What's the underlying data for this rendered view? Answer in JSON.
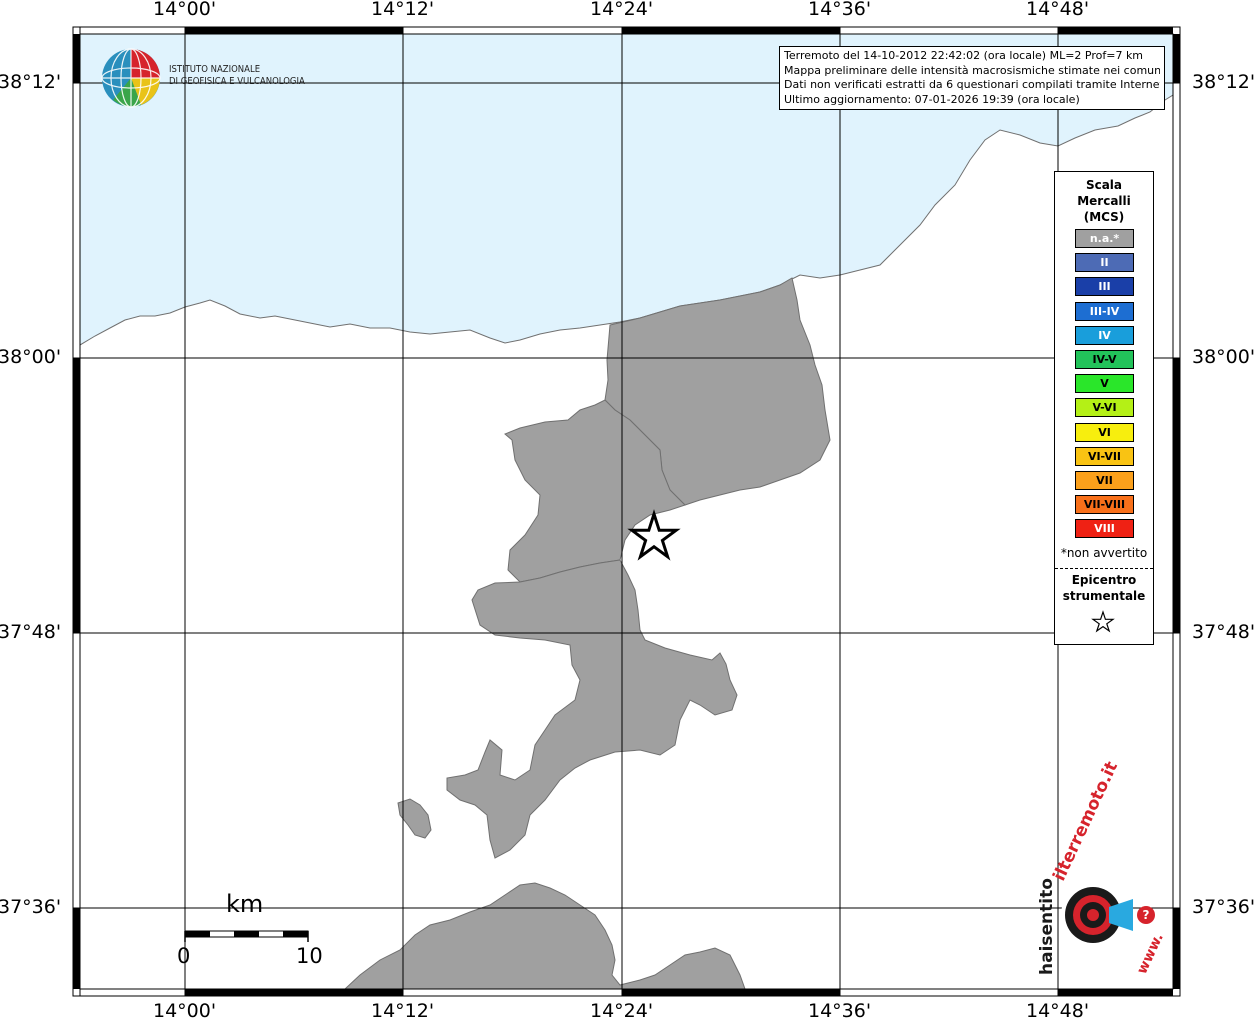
{
  "header_box": {
    "line1": "Terremoto del 14-10-2012 22:42:02 (ora locale) ML=2 Prof=7 km",
    "line2": "Mappa preliminare delle intensità macrosismiche stimate nei comuni",
    "line3": "Dati non verificati estratti da 6 questionari compilati tramite Internet.",
    "line4": "Ultimo aggiornamento: 07-01-2026 19:39 (ora locale)"
  },
  "institute": {
    "line1": "ISTITUTO NAZIONALE",
    "line2": "DI GEOFISICA E VULCANOLOGIA"
  },
  "lon_labels": [
    "14°00'",
    "14°12'",
    "14°24'",
    "14°36'",
    "14°48'"
  ],
  "lat_labels": [
    "38°12'",
    "38°00'",
    "37°48'",
    "37°36'"
  ],
  "legend": {
    "title1": "Scala",
    "title2": "Mercalli",
    "title3": "(MCS)",
    "items": [
      {
        "label": "n.a.*",
        "color": "#a0a0a0",
        "text_color": "#ffffff"
      },
      {
        "label": "II",
        "color": "#4d6bb5",
        "text_color": "#ffffff"
      },
      {
        "label": "III",
        "color": "#1a3fa8",
        "text_color": "#ffffff"
      },
      {
        "label": "III-IV",
        "color": "#1d6ed2",
        "text_color": "#ffffff"
      },
      {
        "label": "IV",
        "color": "#199edb",
        "text_color": "#ffffff"
      },
      {
        "label": "IV-V",
        "color": "#22c35a",
        "text_color": "#000000"
      },
      {
        "label": "V",
        "color": "#2ae62a",
        "text_color": "#000000"
      },
      {
        "label": "V-VI",
        "color": "#b4f016",
        "text_color": "#000000"
      },
      {
        "label": "VI",
        "color": "#f7ee0e",
        "text_color": "#000000"
      },
      {
        "label": "VI-VII",
        "color": "#f9c313",
        "text_color": "#000000"
      },
      {
        "label": "VII",
        "color": "#fba01b",
        "text_color": "#000000"
      },
      {
        "label": "VII-VIII",
        "color": "#f8701a",
        "text_color": "#000000"
      },
      {
        "label": "VIII",
        "color": "#ef2114",
        "text_color": "#ffffff"
      }
    ],
    "note": "*non avvertito",
    "epicenter1": "Epicentro",
    "epicenter2": "strumentale"
  },
  "scale_bar": {
    "unit": "km",
    "start": "0",
    "end": "10"
  },
  "site_logo": {
    "text1": "haisentito",
    "text2": "ilterremoto.it",
    "text3": "www."
  },
  "colors": {
    "sea": "#e0f3fd",
    "municipality": "#a0a0a0"
  }
}
